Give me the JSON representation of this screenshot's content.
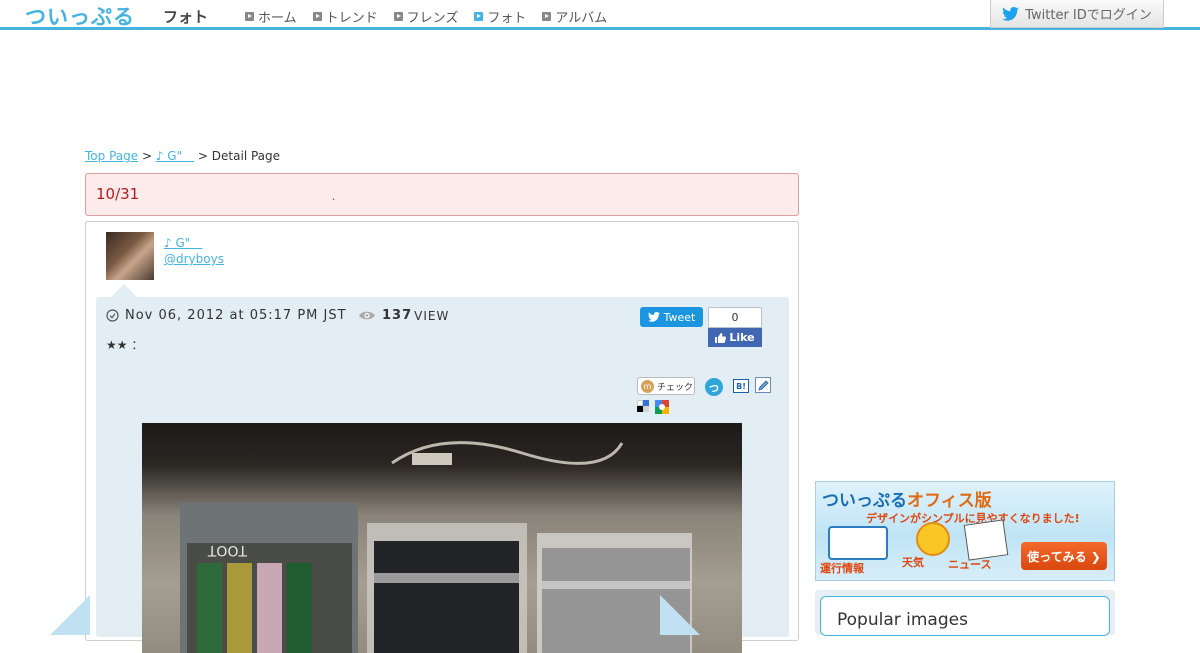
{
  "header": {
    "logo": "ついっぷる",
    "section": "フォト",
    "nav": [
      {
        "label": "ホーム",
        "active": false
      },
      {
        "label": "トレンド",
        "active": false
      },
      {
        "label": "フレンズ",
        "active": false
      },
      {
        "label": "フォト",
        "active": true
      },
      {
        "label": "アルバム",
        "active": false
      }
    ],
    "login_label": "Twitter IDでログイン"
  },
  "breadcrumb": {
    "top": "Top Page",
    "sep1": " > ",
    "user": "♪ G\"＿",
    "sep2": " > ",
    "current": "Detail Page"
  },
  "title": {
    "text": "10/31",
    "mark": "."
  },
  "post": {
    "user_name": "♪ G\"＿",
    "user_handle": "@dryboys",
    "date": "Nov 06, 2012 at 05:17 PM JST",
    "views": "137",
    "views_unit": "VIEW",
    "body": "★★ ：",
    "tweet_label": "Tweet",
    "fb_count": "0",
    "fb_like_label": "Like",
    "mixi_label": "チェック",
    "tsui_label": "つ",
    "hatena_label": "B!"
  },
  "sidebar": {
    "banner": {
      "logo_main": "ついっぷる",
      "logo_sub": "オフィス版",
      "tagline": "デザインがシンプルに見やすくなりました!",
      "label_train": "運行情報",
      "label_weather": "天気",
      "label_news": "ニュース",
      "cta": "使ってみる ❯"
    },
    "popular_title": "Popular images"
  },
  "colors": {
    "accent": "#45b3e0",
    "title_red": "#b41c1c",
    "panel": "#e3edf4"
  }
}
